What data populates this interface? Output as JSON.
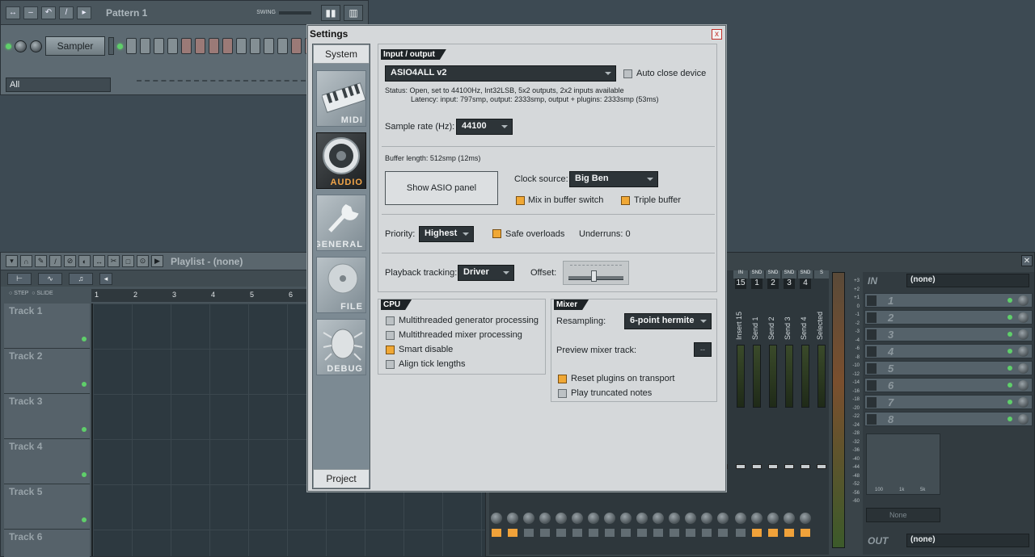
{
  "rack": {
    "pattern": "Pattern 1",
    "swing_label": "SWING",
    "sampler_label": "Sampler",
    "filter_value": "All"
  },
  "playlist": {
    "title": "Playlist - (none)",
    "snap_step": "STEP",
    "snap_slide": "SLIDE",
    "ruler": [
      "1",
      "2",
      "3",
      "4",
      "5",
      "6"
    ],
    "tracks": [
      "Track 1",
      "Track 2",
      "Track 3",
      "Track 4",
      "Track 5",
      "Track 6"
    ]
  },
  "mixer": {
    "strip_labels": [
      "IN",
      "SND",
      "SND",
      "SND",
      "SND",
      "S"
    ],
    "strip_numbers": [
      "15",
      "1",
      "2",
      "3",
      "4"
    ],
    "strip_names": [
      "Insert 15",
      "Send 1",
      "Send 2",
      "Send 3",
      "Send 4",
      "Selected"
    ],
    "db_scale": [
      "+3",
      "+2",
      "+1",
      "0",
      "-1",
      "-2",
      "-3",
      "-4",
      "-6",
      "-8",
      "-10",
      "-12",
      "-14",
      "-16",
      "-18",
      "-20",
      "-22",
      "-24",
      "-28",
      "-32",
      "-36",
      "-40",
      "-44",
      "-48",
      "-52",
      "-56",
      "-60"
    ],
    "in_label": "IN",
    "in_value": "(none)",
    "out_label": "OUT",
    "out_value": "(none)",
    "slots": [
      "1",
      "2",
      "3",
      "4",
      "5",
      "6",
      "7",
      "8"
    ],
    "eq_labels": [
      "100",
      "1k",
      "5k"
    ],
    "none_label": "None"
  },
  "settings": {
    "title": "Settings",
    "close": "x",
    "tab_system": "System",
    "tab_project": "Project",
    "side_items": [
      "MIDI",
      "AUDIO",
      "GENERAL",
      "FILE",
      "DEBUG"
    ],
    "io": {
      "header": "Input / output",
      "device": "ASIO4ALL v2",
      "auto_close": "Auto close device",
      "status": "Status: Open, set to 44100Hz, Int32LSB, 5x2 outputs, 2x2 inputs available",
      "latency": "Latency: input: 797smp, output: 2333smp, output + plugins: 2333smp (53ms)",
      "sample_rate_label": "Sample rate (Hz):",
      "sample_rate": "44100",
      "buffer_length": "Buffer length: 512smp (12ms)",
      "show_asio": "Show ASIO panel",
      "clock_source_label": "Clock source:",
      "clock_source": "Big Ben",
      "mix_buffer_switch": "Mix in buffer switch",
      "triple_buffer": "Triple buffer",
      "priority_label": "Priority:",
      "priority": "Highest",
      "safe_overloads": "Safe overloads",
      "underruns": "Underruns: 0",
      "playback_tracking_label": "Playback tracking:",
      "playback_tracking": "Driver",
      "offset_label": "Offset:"
    },
    "cpu": {
      "header": "CPU",
      "multi_gen": "Multithreaded generator processing",
      "multi_mix": "Multithreaded mixer processing",
      "smart_disable": "Smart disable",
      "align_tick": "Align tick lengths"
    },
    "mixer": {
      "header": "Mixer",
      "resampling_label": "Resampling:",
      "resampling": "6-point hermite",
      "preview_label": "Preview mixer track:",
      "preview_value": "--",
      "reset_plugins": "Reset plugins on transport",
      "play_truncated": "Play truncated notes"
    }
  }
}
